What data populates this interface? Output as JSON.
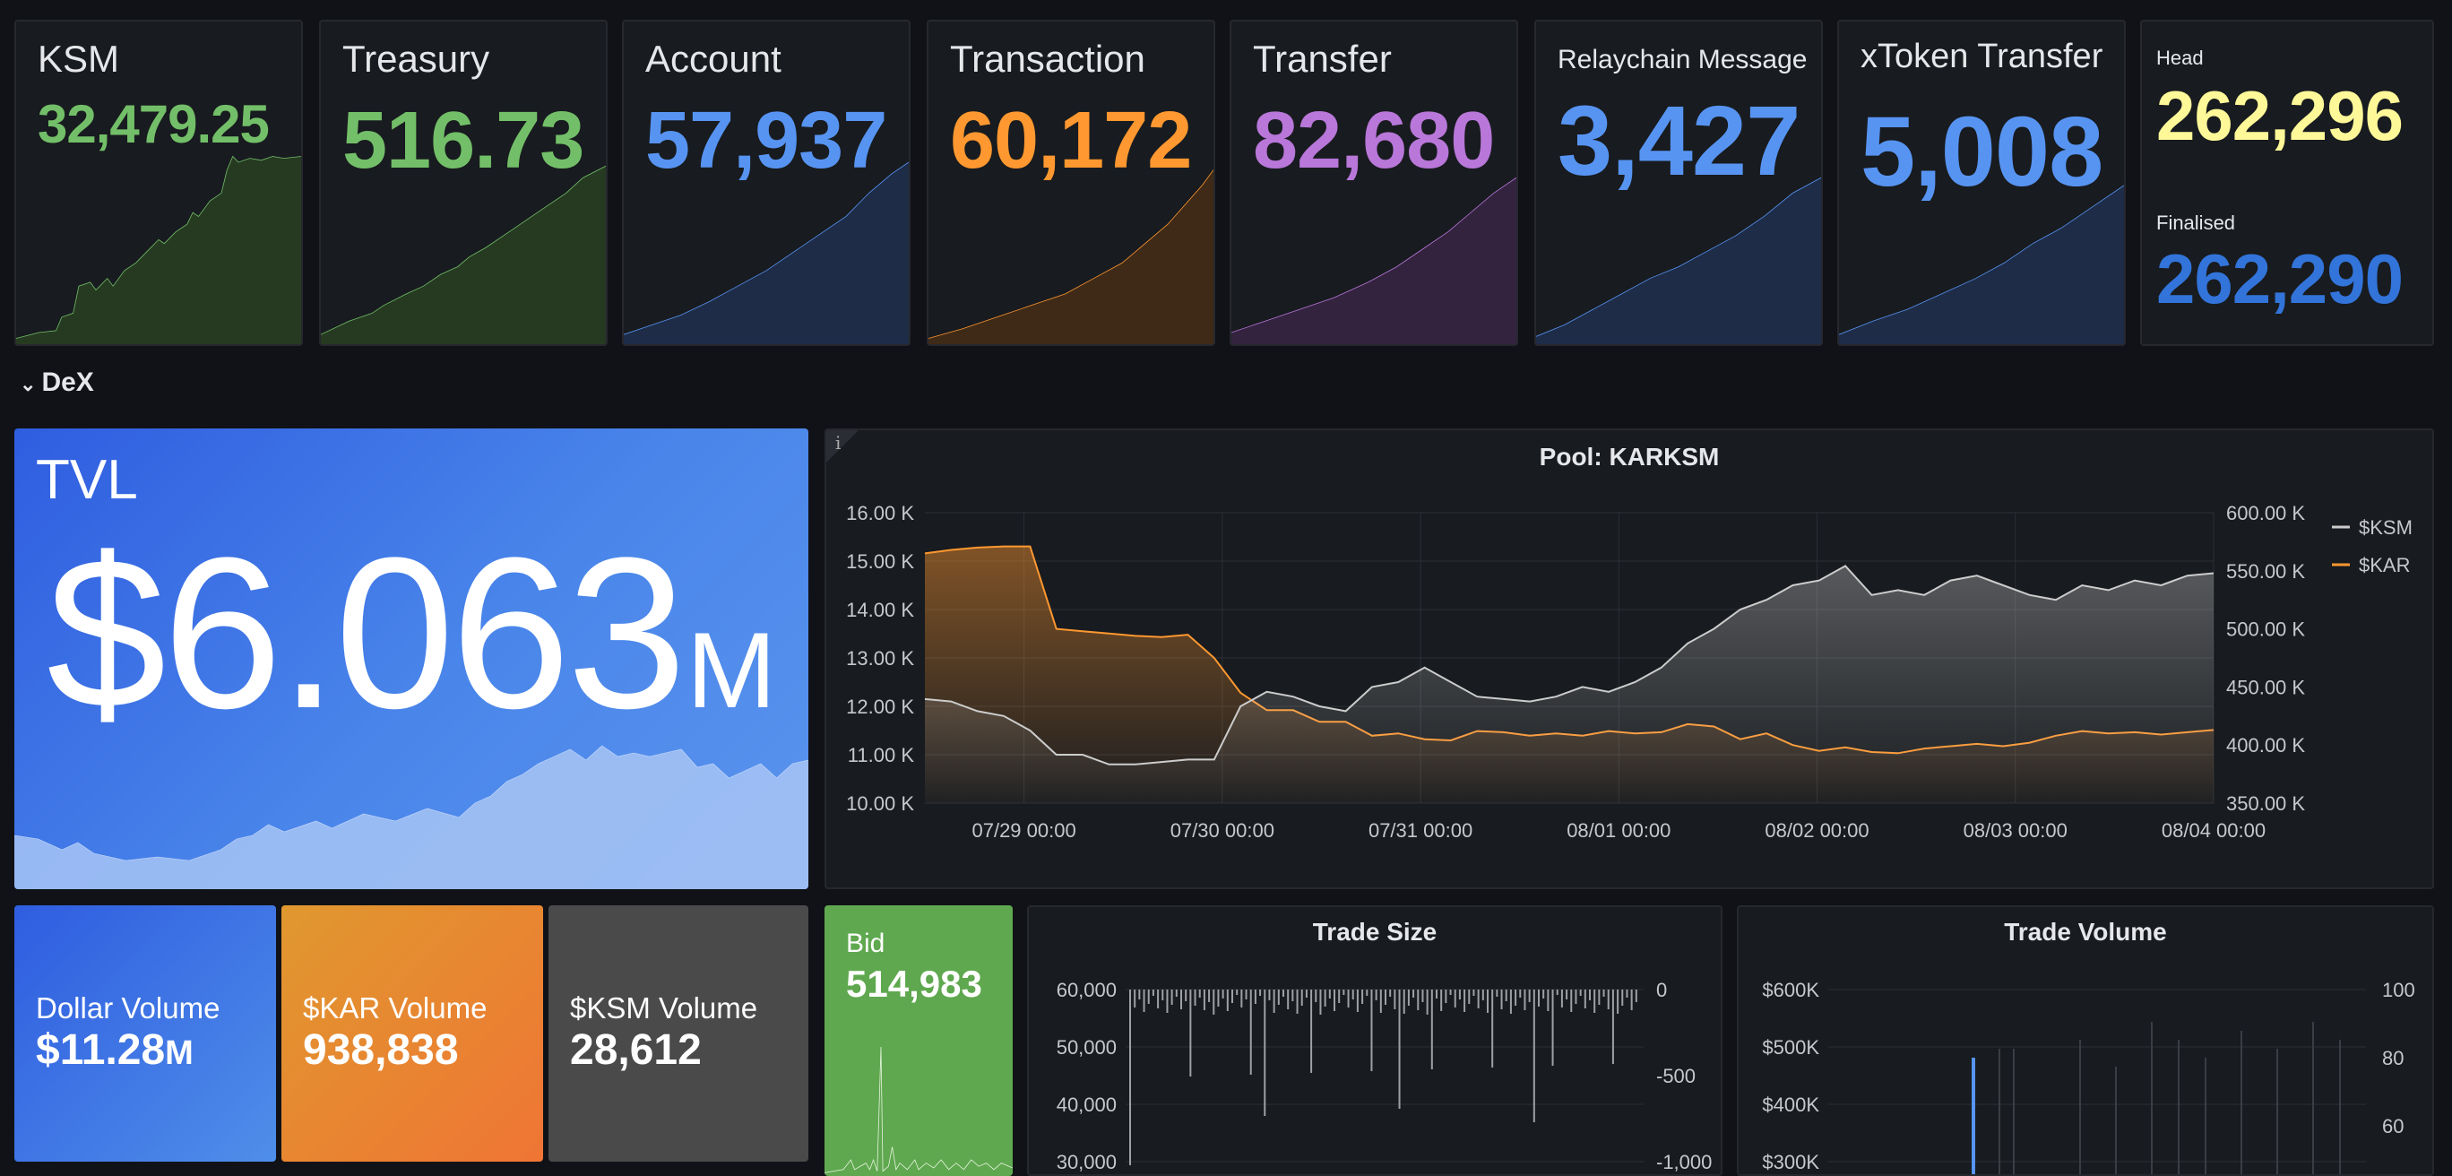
{
  "stats": [
    {
      "title": "KSM",
      "value": "32,479.25",
      "color": "#73bf69",
      "fill": "#263a22"
    },
    {
      "title": "Treasury",
      "value": "516.73",
      "color": "#73bf69",
      "fill": "#263a22"
    },
    {
      "title": "Account",
      "value": "57,937",
      "color": "#5794f2",
      "fill": "#1e2c48"
    },
    {
      "title": "Transaction",
      "value": "60,172",
      "color": "#ff9830",
      "fill": "#3f2a17"
    },
    {
      "title": "Transfer",
      "value": "82,680",
      "color": "#b877d9",
      "fill": "#33233f"
    },
    {
      "title": "Relaychain Message",
      "value": "3,427",
      "color": "#5794f2",
      "fill": "#1e2c48"
    },
    {
      "title": "xToken Transfer",
      "value": "5,008",
      "color": "#5794f2",
      "fill": "#1e2c48"
    }
  ],
  "head_panel": {
    "head_label": "Head",
    "head_value": "262,296",
    "head_color": "#fff899",
    "finalised_label": "Finalised",
    "finalised_value": "262,290",
    "finalised_color": "#3274d9"
  },
  "row": {
    "title": "DeX",
    "icon": "chevron-down-icon"
  },
  "tvl": {
    "label": "TVL",
    "value": "$6.063",
    "unit": "M"
  },
  "pool_chart": {
    "title": "Pool: KARKSM",
    "info_icon": "i",
    "chart_data": {
      "type": "line",
      "title": "Pool: KARKSM",
      "x_ticks": [
        "07/29 00:00",
        "07/30 00:00",
        "07/31 00:00",
        "08/01 00:00",
        "08/02 00:00",
        "08/03 00:00",
        "08/04 00:00"
      ],
      "y_left_ticks": [
        "16.00 K",
        "15.00 K",
        "14.00 K",
        "13.00 K",
        "12.00 K",
        "11.00 K",
        "10.00 K"
      ],
      "y_right_ticks": [
        "600.00 K",
        "550.00 K",
        "500.00 K",
        "450.00 K",
        "400.00 K",
        "350.00 K"
      ],
      "ylim_left": [
        10000,
        16000
      ],
      "ylim_right": [
        350000,
        600000
      ],
      "grid": true,
      "legend_position": "top-right",
      "series": [
        {
          "name": "$KSM",
          "color": "#cccccc",
          "axis": "left",
          "values": [
            12150,
            12100,
            11900,
            11800,
            11500,
            11000,
            11000,
            10800,
            10800,
            10850,
            10900,
            10900,
            12000,
            12300,
            12200,
            12000,
            11900,
            12400,
            12500,
            12800,
            12500,
            12200,
            12150,
            12100,
            12200,
            12400,
            12300,
            12500,
            12800,
            13300,
            13600,
            14000,
            14200,
            14500,
            14600,
            14900,
            14300,
            14400,
            14300,
            14600,
            14700,
            14500,
            14300,
            14200,
            14500,
            14400,
            14600,
            14500,
            14700,
            14750
          ]
        },
        {
          "name": "$KAR",
          "color": "#ff9830",
          "axis": "right",
          "values": [
            565000,
            568000,
            570000,
            571000,
            571000,
            500000,
            498000,
            496000,
            494000,
            493000,
            495000,
            475000,
            445000,
            430000,
            430000,
            420000,
            420000,
            408000,
            410000,
            405000,
            404000,
            412000,
            411000,
            408000,
            410000,
            408000,
            412000,
            410000,
            411000,
            418000,
            416000,
            405000,
            410000,
            400000,
            395000,
            398000,
            394000,
            393000,
            397000,
            399000,
            401000,
            399000,
            402000,
            408000,
            412000,
            410000,
            411000,
            409000,
            411000,
            413000
          ]
        }
      ]
    }
  },
  "volumes": [
    {
      "label": "Dollar Volume",
      "value": "$11.28",
      "unit": "M"
    },
    {
      "label": "$KAR Volume",
      "value": "938,838",
      "unit": ""
    },
    {
      "label": "$KSM Volume",
      "value": "28,612",
      "unit": ""
    }
  ],
  "bid": {
    "label": "Bid",
    "value": "514,983"
  },
  "trade_size": {
    "title": "Trade Size",
    "chart_data": {
      "type": "bar",
      "title": "Trade Size",
      "y_left_ticks": [
        "60,000",
        "50,000",
        "40,000",
        "30,000"
      ],
      "y_right_ticks": [
        "0",
        "-500",
        "-1,000"
      ],
      "grid": true
    }
  },
  "trade_volume": {
    "title": "Trade Volume",
    "chart_data": {
      "type": "bar",
      "title": "Trade Volume",
      "y_left_ticks": [
        "$600K",
        "$500K",
        "$400K",
        "$300K"
      ],
      "y_right_ticks": [
        "100",
        "80",
        "60"
      ],
      "grid": true
    }
  }
}
